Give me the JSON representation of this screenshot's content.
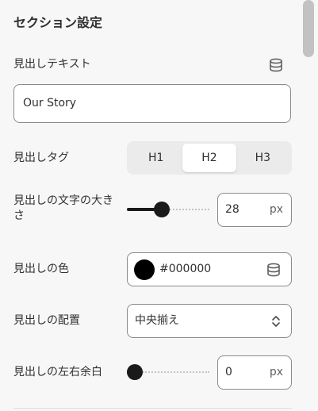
{
  "section": {
    "title": "セクション設定"
  },
  "heading_text": {
    "label": "見出しテキスト",
    "value": "Our Story",
    "icon": "database-icon"
  },
  "heading_tag": {
    "label": "見出しタグ",
    "options": [
      "H1",
      "H2",
      "H3"
    ],
    "selected": "H2"
  },
  "font_size": {
    "label": "見出しの文字の大きさ",
    "value": "28",
    "unit": "px",
    "slider_fraction": 0.4
  },
  "heading_color": {
    "label": "見出しの色",
    "value": "#000000",
    "swatch": "#000000",
    "icon": "database-icon"
  },
  "alignment": {
    "label": "見出しの配置",
    "value": "中央揃え",
    "icon": "chevron-up-down-icon"
  },
  "side_margin": {
    "label": "見出しの左右余白",
    "value": "0",
    "unit": "px",
    "slider_fraction": 0.0
  },
  "colors": {
    "text": "#303030",
    "border": "#8a8a8a",
    "slider": "#1a1a1a"
  }
}
